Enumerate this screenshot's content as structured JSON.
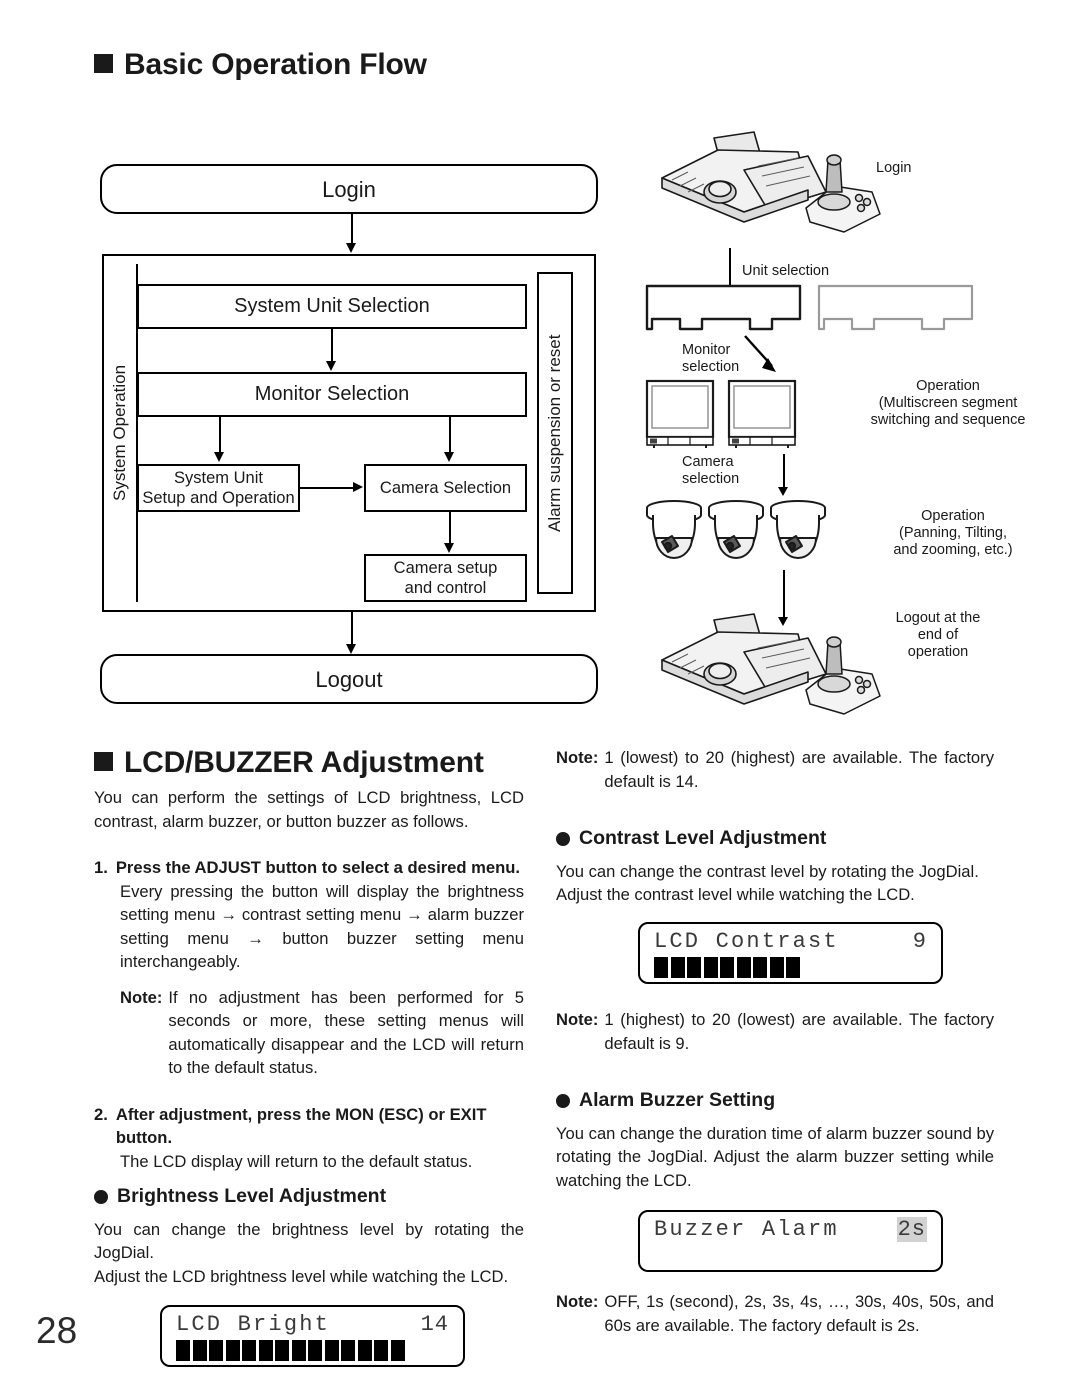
{
  "page_number": "28",
  "sections": {
    "flow": {
      "heading": "Basic Operation Flow"
    },
    "lcd": {
      "heading": "LCD/BUZZER Adjustment"
    }
  },
  "flow_diagram": {
    "login": "Login",
    "logout": "Logout",
    "system_operation_label": "System Operation",
    "alarm_label": "Alarm suspension or reset",
    "system_unit_selection": "System Unit Selection",
    "monitor_selection": "Monitor Selection",
    "system_unit_setup": "System Unit\nSetup and Operation",
    "system_unit_setup_line1": "System Unit",
    "system_unit_setup_line2": "Setup and Operation",
    "camera_selection": "Camera Selection",
    "camera_setup_line1": "Camera setup",
    "camera_setup_line2": "and control"
  },
  "illustration": {
    "login": "Login",
    "unit_selection": "Unit selection",
    "monitor_selection_line1": "Monitor",
    "monitor_selection_line2": "selection",
    "operation_multiscreen_line1": "Operation",
    "operation_multiscreen_line2": "(Multiscreen segment",
    "operation_multiscreen_line3": "switching and sequence",
    "camera_selection_line1": "Camera",
    "camera_selection_line2": "selection",
    "operation_ptz_line1": "Operation",
    "operation_ptz_line2": "(Panning, Tilting,",
    "operation_ptz_line3": "and zooming, etc.)",
    "logout_line1": "Logout at the",
    "logout_line2": "end of",
    "logout_line3": "operation"
  },
  "left_column": {
    "intro": "You can perform the settings of LCD brightness, LCD contrast, alarm buzzer, or button buzzer as follows.",
    "step1_num": "1.",
    "step1_title": "Press the ADJUST button to select a desired menu.",
    "step1_body": "Every pressing the button will display the brightness setting menu → contrast setting menu → alarm buzzer setting menu → button buzzer setting menu interchangeably.",
    "note1_label": "Note:",
    "note1_body": "If no adjustment has been performed for 5 seconds or more, these setting menus will automatically disappear and the LCD will return to the default status.",
    "step2_num": "2.",
    "step2_title": "After adjustment, press the MON (ESC) or EXIT button.",
    "step2_body": "The LCD display will return to the default status.",
    "brightness_heading": "Brightness Level Adjustment",
    "brightness_body1": "You can change the brightness level by rotating the JogDial.",
    "brightness_body2": "Adjust the LCD brightness level while watching the LCD."
  },
  "right_column": {
    "note_brightness_label": "Note:",
    "note_brightness_body": "1 (lowest) to 20 (highest) are available. The factory default is 14.",
    "contrast_heading": "Contrast Level Adjustment",
    "contrast_body1": "You can change the contrast level by rotating the JogDial.",
    "contrast_body2": "Adjust the contrast level while watching the LCD.",
    "note_contrast_label": "Note:",
    "note_contrast_body": "1 (highest) to 20 (lowest) are available. The factory default is 9.",
    "alarm_heading": "Alarm Buzzer Setting",
    "alarm_body": "You can change the duration time of alarm buzzer sound by rotating the JogDial. Adjust the alarm buzzer setting while watching the LCD.",
    "note_alarm_label": "Note:",
    "note_alarm_body": "OFF, 1s (second), 2s, 3s, 4s, …, 30s, 40s, 50s, and 60s are available. The factory default is 2s."
  },
  "lcd_displays": {
    "brightness": {
      "label": "LCD Bright",
      "value": "14",
      "segments": 14,
      "highlight": false
    },
    "contrast": {
      "label": "LCD Contrast",
      "value": "9",
      "segments": 9,
      "highlight": false
    },
    "buzzer": {
      "label": "Buzzer Alarm",
      "value": "2s",
      "segments": 0,
      "highlight": true
    }
  }
}
